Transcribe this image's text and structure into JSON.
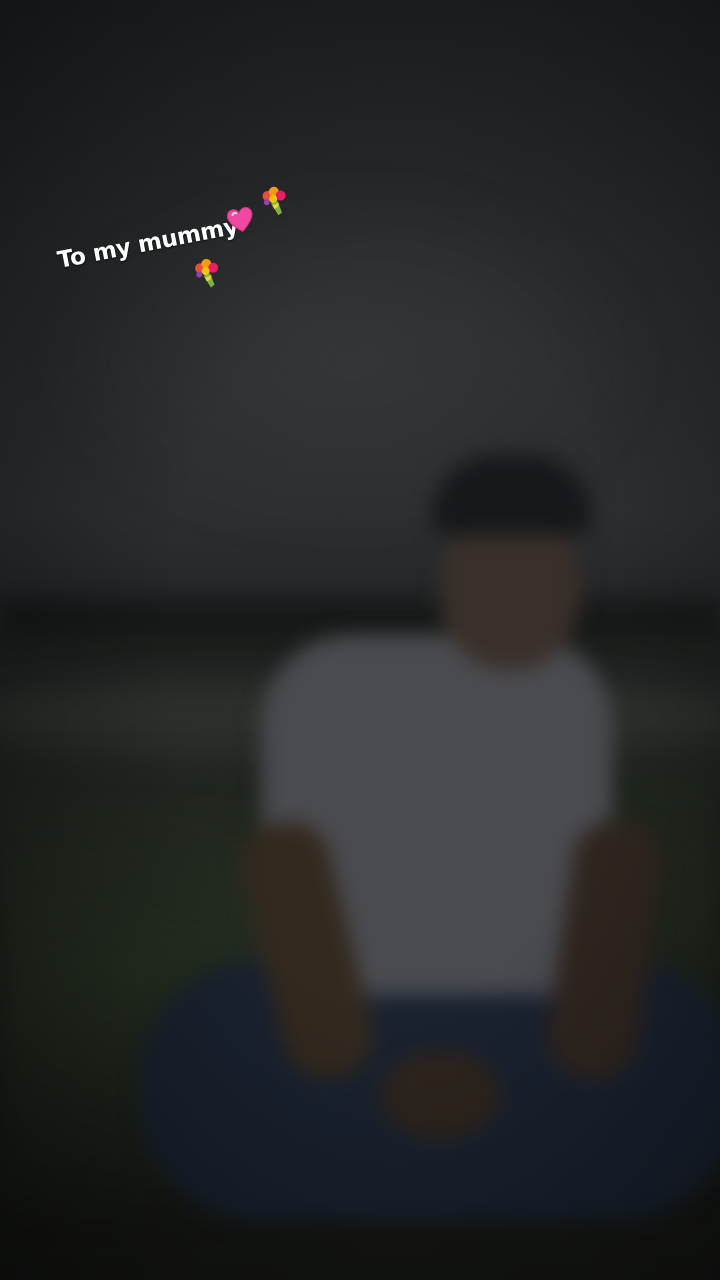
{
  "story": {
    "caption": {
      "text": "To my mummy",
      "emojis": [
        "pink-heart-icon",
        "bouquet-icon",
        "bouquet-icon"
      ]
    }
  }
}
